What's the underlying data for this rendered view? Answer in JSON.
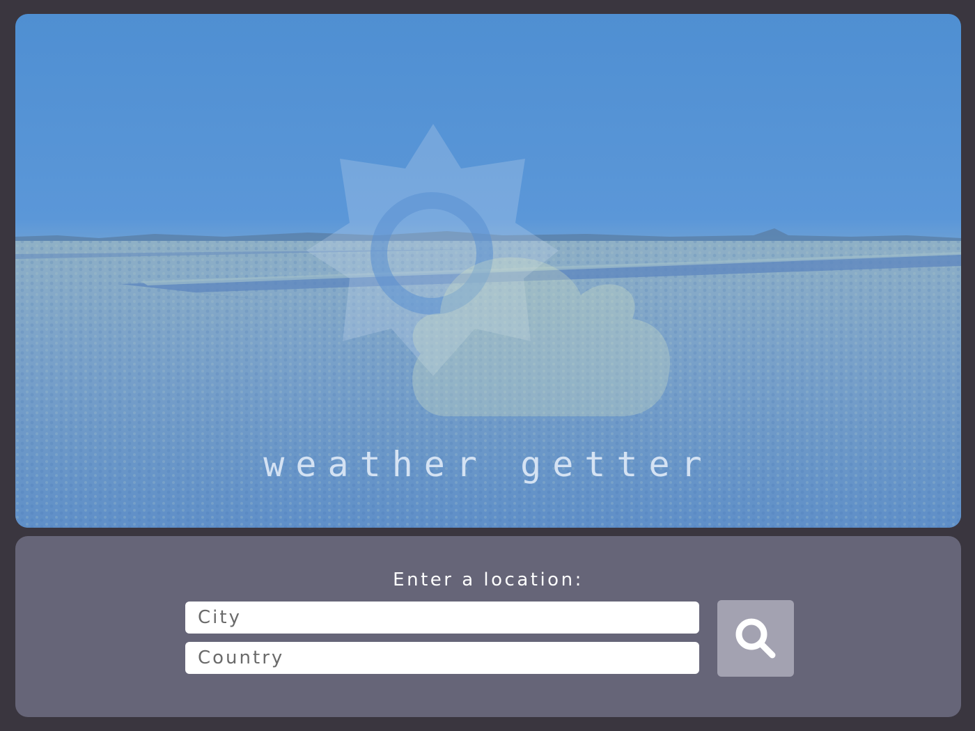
{
  "app": {
    "title": "weather getter",
    "logo_icon": "sun-cloud-icon"
  },
  "search": {
    "prompt": "Enter a location:",
    "city_placeholder": "City",
    "country_placeholder": "Country",
    "button_icon": "search-icon"
  },
  "colors": {
    "page_background": "#3a363f",
    "panel_background": "#666578",
    "search_button": "#a3a2b1",
    "sky": "#5b97d8"
  }
}
